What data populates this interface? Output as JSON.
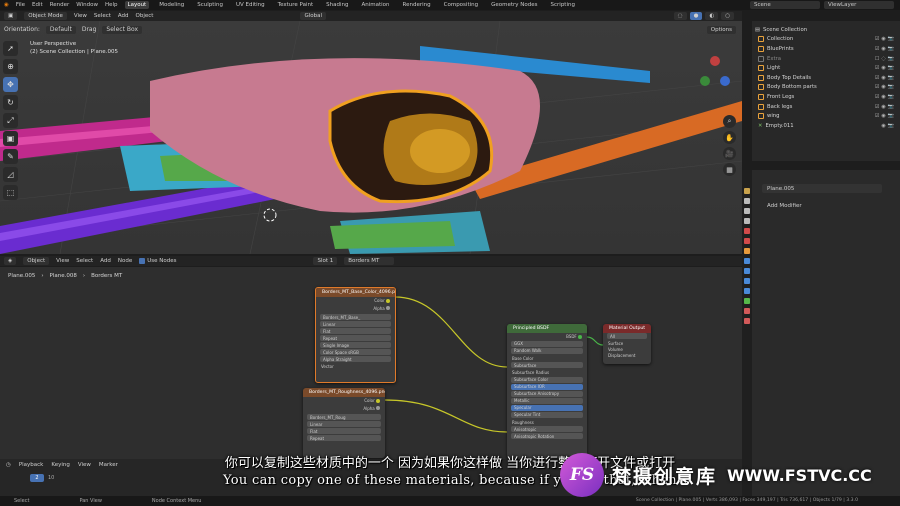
{
  "topbar": {
    "menus": [
      "File",
      "Edit",
      "Render",
      "Window",
      "Help"
    ],
    "workspaces": [
      "Layout",
      "Modeling",
      "Sculpting",
      "UV Editing",
      "Texture Paint",
      "Shading",
      "Animation",
      "Rendering",
      "Compositing",
      "Geometry Nodes",
      "Scripting"
    ],
    "active_workspace": "Layout",
    "scene": "Scene",
    "view_layer": "ViewLayer"
  },
  "viewport_header": {
    "mode": "Object Mode",
    "menus": [
      "View",
      "Select",
      "Add",
      "Object"
    ],
    "transform": "Global"
  },
  "viewport_tool_header": {
    "orientation_label": "Orientation:",
    "orientation_value": "Default",
    "drag_label": "Drag",
    "drag_value": "Select Box",
    "options": "Options"
  },
  "viewport": {
    "perspective": "User Perspective",
    "collection_line": "(2) Scene Collection | Plane.005"
  },
  "outliner": {
    "root": "Scene Collection",
    "items": [
      {
        "label": "Collection"
      },
      {
        "label": "BluePrints"
      },
      {
        "label": "Extra"
      },
      {
        "label": "Light"
      },
      {
        "label": "Body Top Details"
      },
      {
        "label": "Body Bottom parts"
      },
      {
        "label": "Front Legs"
      },
      {
        "label": "Back legs"
      },
      {
        "label": "wing"
      },
      {
        "label": "Empty.011"
      }
    ]
  },
  "properties": {
    "object_name": "Plane.005",
    "add_modifier": "Add Modifier"
  },
  "node_header": {
    "type": "Object",
    "menus": [
      "View",
      "Select",
      "Add",
      "Node"
    ],
    "use_nodes": "Use Nodes",
    "slot": "Slot 1",
    "material": "Borders MT"
  },
  "breadcrumb": [
    "Plane.005",
    "Plane.008",
    "Borders MT"
  ],
  "nodes": {
    "image1": {
      "title": "Borders_MT_Base_Color_4096.png",
      "out_color": "Color",
      "out_alpha": "Alpha",
      "image_name": "Borders_MT_Base_",
      "fields": [
        "Linear",
        "Flat",
        "Repeat",
        "Single Image",
        "Color Space  sRGB",
        "Alpha  Straight"
      ],
      "vector": "Vector"
    },
    "image2": {
      "title": "Borders_MT_Roughness_4096.png",
      "out_color": "Color",
      "out_alpha": "Alpha",
      "image_name": "Borders_MT_Roug",
      "fields": [
        "Linear",
        "Flat",
        "Repeat"
      ]
    },
    "principled": {
      "title": "Principled BSDF",
      "out": "BSDF",
      "rows": [
        "GGX",
        "Random Walk",
        "Base Color",
        "Subsurface",
        "Subsurface Radius",
        "Subsurface Color",
        "Subsurface IOR",
        "Subsurface Anisotropy",
        "Metallic",
        "Specular",
        "Specular Tint",
        "Roughness",
        "Anisotropic",
        "Anisotropic Rotation"
      ]
    },
    "output": {
      "title": "Material Output",
      "target": "All",
      "inputs": [
        "Surface",
        "Volume",
        "Displacement"
      ]
    }
  },
  "timeline": {
    "menus": [
      "Playback",
      "Keying",
      "View",
      "Marker"
    ],
    "current_frame": "2",
    "next_mark": "10"
  },
  "statusbar": {
    "select": "Select",
    "pan": "Pan View",
    "context": "Node Context Menu",
    "right": "Scene Collection | Plane.005 | Verts 386,093 | Faces 349,197 | Tris 736,617 | Objects 1/79 | 3.3.0"
  },
  "subtitles": {
    "cn": "你可以复制这些材质中的一个 因为如果你这样做 当你进行整个打开文件或打开",
    "en": "You can copy one of these materials, because if you do that, when"
  },
  "watermark": {
    "logo": "FS",
    "cn": "梵摄创意库",
    "url": "WWW.FSTVC.CC"
  }
}
